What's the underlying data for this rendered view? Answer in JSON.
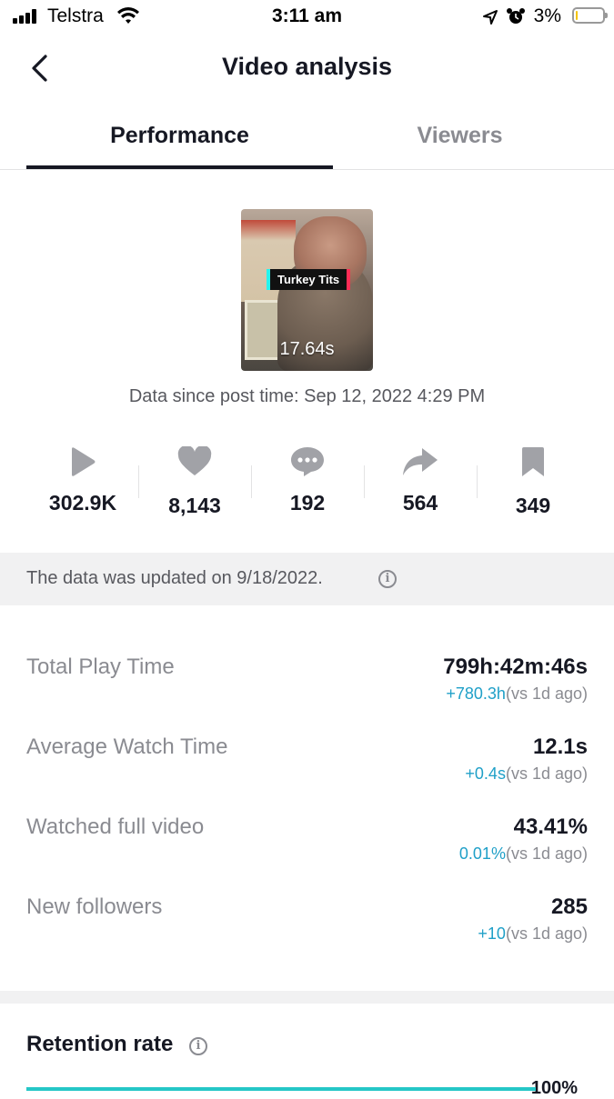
{
  "status_bar": {
    "carrier": "Telstra",
    "time": "3:11 am",
    "battery": "3%"
  },
  "header": {
    "title": "Video analysis"
  },
  "tabs": [
    {
      "label": "Performance",
      "active": true
    },
    {
      "label": "Viewers",
      "active": false
    }
  ],
  "video": {
    "caption": "Turkey Tits",
    "duration": "17.64s",
    "since": "Data since post time: Sep 12, 2022 4:29 PM"
  },
  "stats": {
    "views": "302.9K",
    "likes": "8,143",
    "comments": "192",
    "shares": "564",
    "saves": "349"
  },
  "banner": {
    "text": "The data was updated on 9/18/2022."
  },
  "metrics": [
    {
      "label": "Total Play Time",
      "value": "799h:42m:46s",
      "change": "+780.3h",
      "compare": "(vs 1d ago)"
    },
    {
      "label": "Average Watch Time",
      "value": "12.1s",
      "change": "+0.4s",
      "compare": "(vs 1d ago)"
    },
    {
      "label": "Watched full video",
      "value": "43.41%",
      "change": "0.01%",
      "compare": "(vs 1d ago)"
    },
    {
      "label": "New followers",
      "value": "285",
      "change": "+10",
      "compare": "(vs 1d ago)"
    }
  ],
  "retention": {
    "title": "Retention rate",
    "percent": "100%"
  },
  "colors": {
    "accent_blue": "#20a0c8",
    "text_primary": "#161823",
    "text_secondary": "#8a8b91"
  }
}
